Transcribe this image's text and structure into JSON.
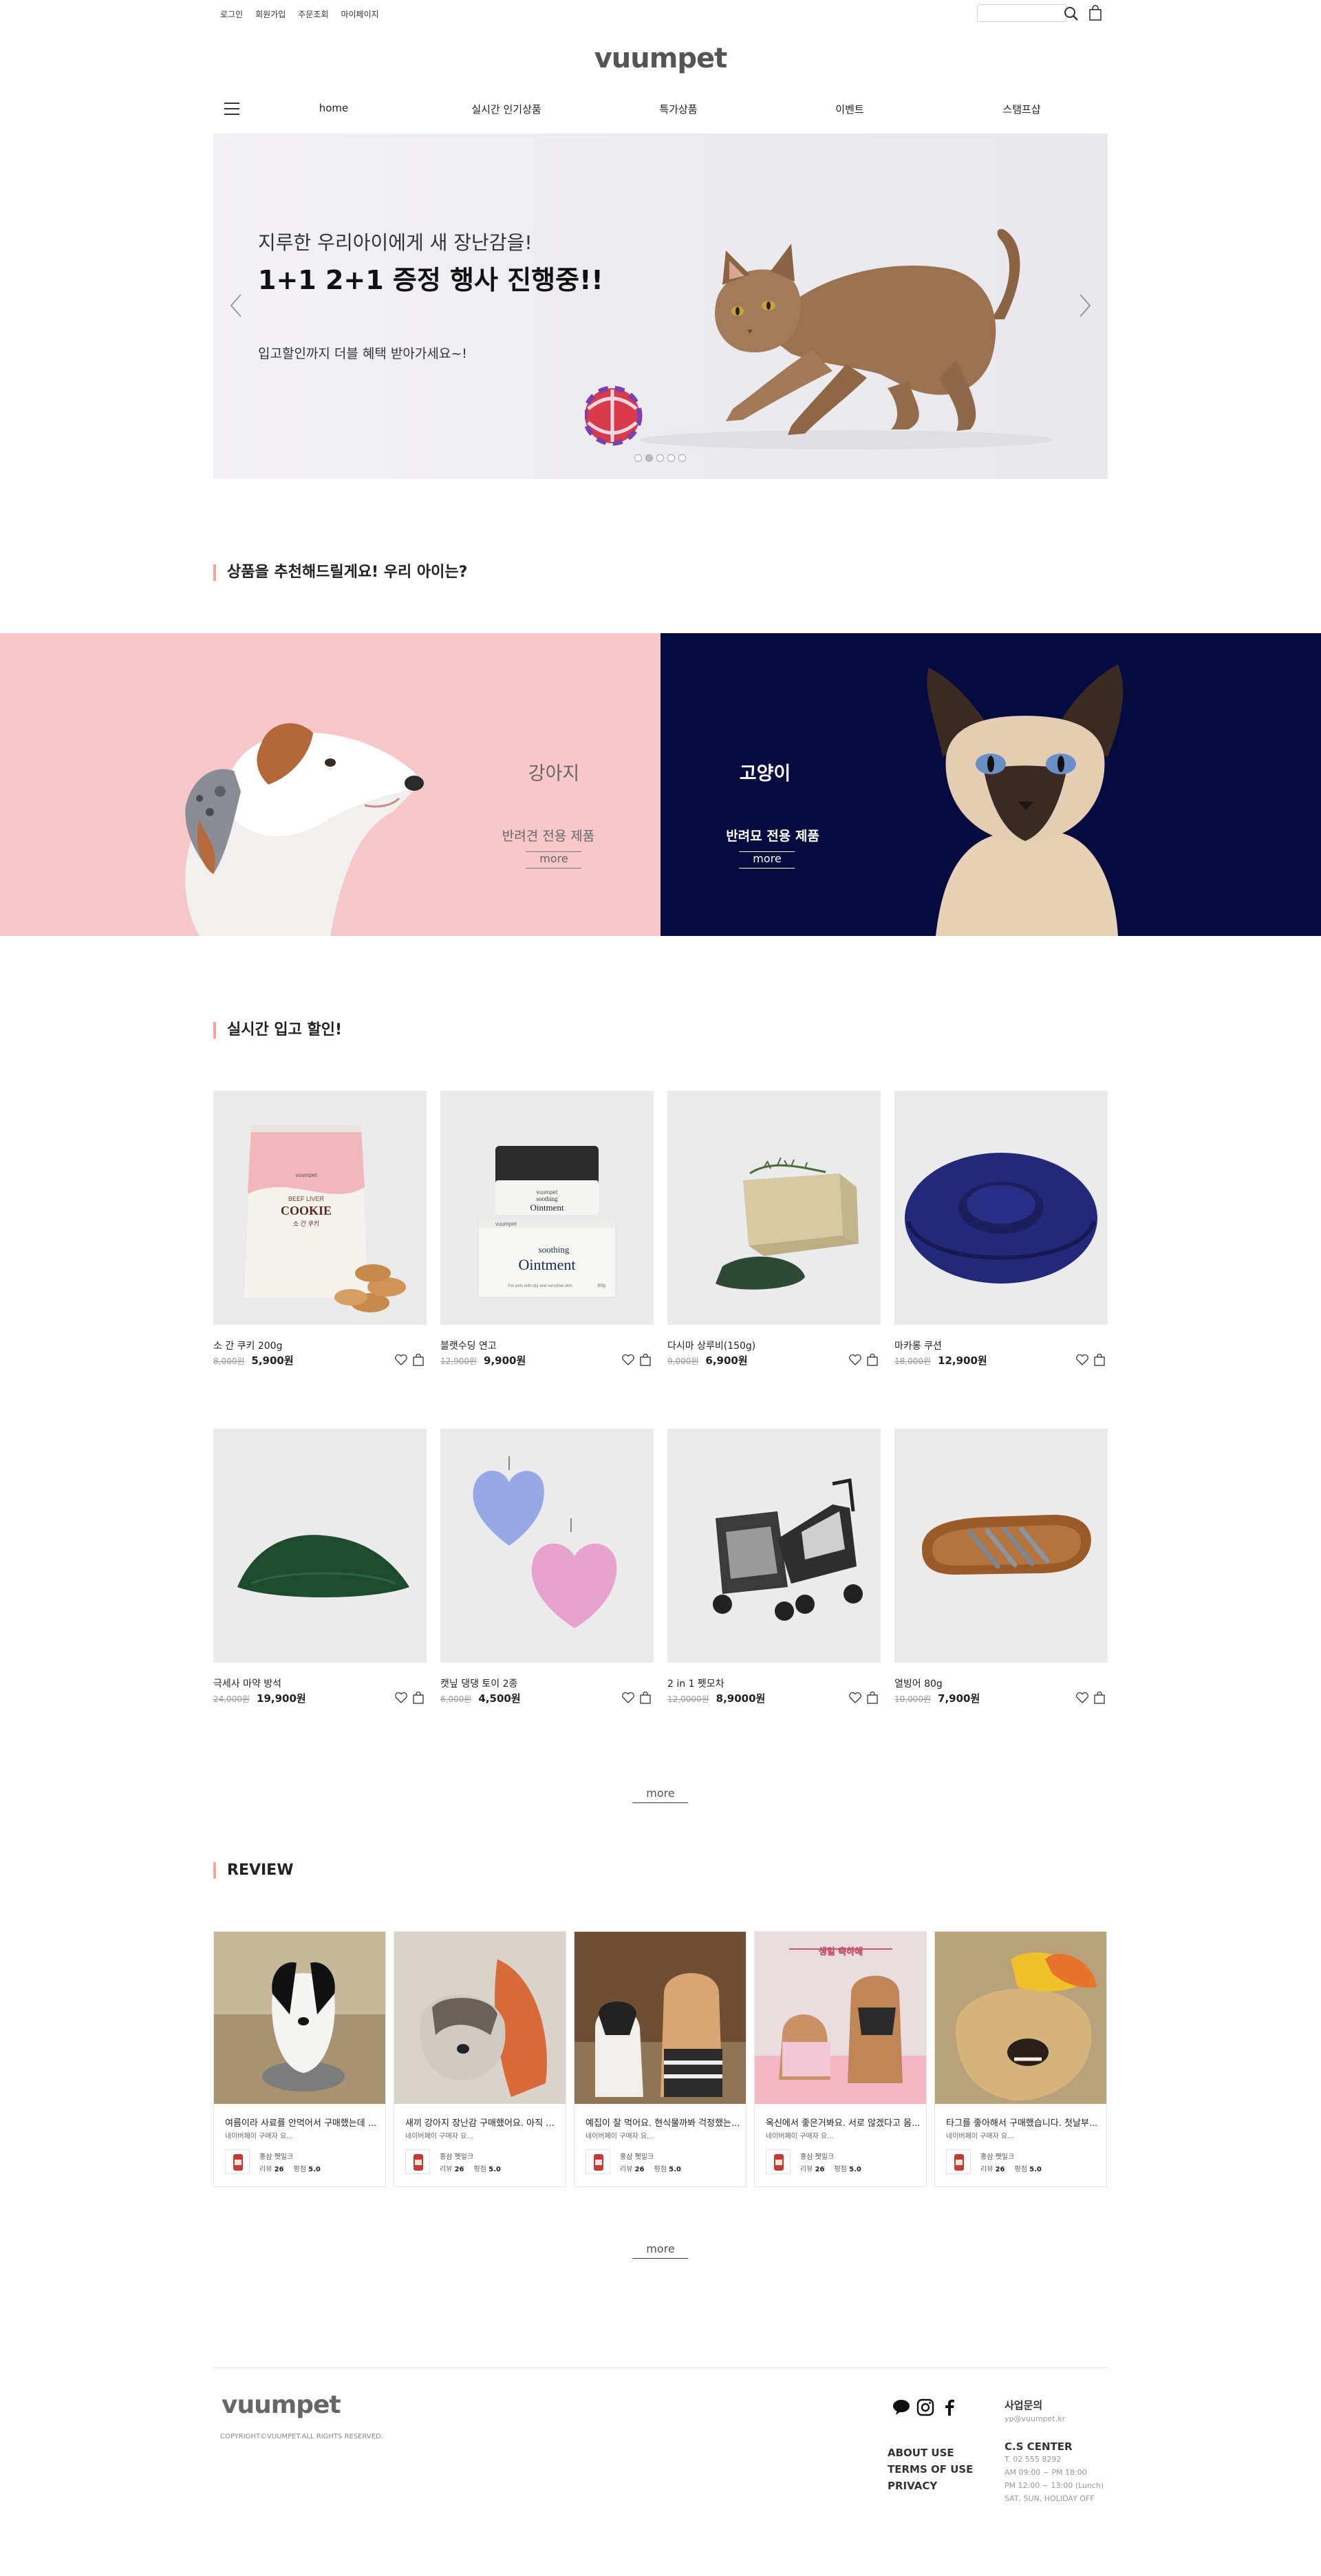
{
  "topbar": {
    "links": [
      "로그인",
      "회원가입",
      "주문조회",
      "마이페이지"
    ],
    "search_placeholder": ""
  },
  "brand": {
    "logo": "vuumpet"
  },
  "nav": {
    "items": [
      "home",
      "실시간 인기상품",
      "특가상품",
      "이벤트",
      "스탬프샵"
    ]
  },
  "hero": {
    "sub": "지루한 우리아이에게 새 장난감을!",
    "headline": "1+1 2+1 증정 행사 진행중!!",
    "desc": "입고할인까지 더블 혜택 받아가세요~!",
    "slide_count": 5,
    "active_slide": 2
  },
  "recommend": {
    "title": "상품을 추천해드릴게요! 우리 아이는?",
    "dog": {
      "label": "강아지",
      "desc": "반려견 전용 제품",
      "more": "more"
    },
    "cat": {
      "label": "고양이",
      "desc": "반려묘 전용 제품",
      "more": "more"
    }
  },
  "products": {
    "title": "실시간 입고 할인!",
    "items": [
      {
        "name": "소 간 쿠키 200g",
        "old": "8,000원",
        "price": "5,900원"
      },
      {
        "name": "블랫수딩 연고",
        "old": "12,900원",
        "price": "9,900원"
      },
      {
        "name": "다시마 상루비(150g)",
        "old": "9,000원",
        "price": "6,900원"
      },
      {
        "name": "마카롱 쿠션",
        "old": "18,000원",
        "price": "12,900원"
      },
      {
        "name": "극세사 마약 방석",
        "old": "24,000원",
        "price": "19,900원"
      },
      {
        "name": "캣닢 댕댕 토이 2종",
        "old": "6,000원",
        "price": "4,500원"
      },
      {
        "name": "2 in 1 펫모차",
        "old": "12,0000원",
        "price": "8,9000원"
      },
      {
        "name": "열빙어 80g",
        "old": "10,000원",
        "price": "7,900원"
      }
    ],
    "more": "more",
    "cookie_pack": {
      "brand": "vuumpet",
      "line1": "BEEF LIVER",
      "line2": "COOKIE",
      "line3": "소 간 쿠키"
    },
    "ointment": {
      "jar_brand": "vuumpet",
      "jar_line1": "soothing",
      "jar_line2": "Ointment",
      "box_brand": "vuumpet",
      "box_line1": "soothing",
      "box_line2": "Ointment",
      "box_small": "For pets with dry and sensitive skin",
      "box_weight": "60g"
    }
  },
  "reviews": {
    "title": "REVIEW",
    "items": [
      {
        "title": "여름이라 사료를 안먹어서 구매했는데 ...",
        "text": "네이버페이 구매자 요...",
        "product": "홍삼 펫밀크",
        "count": "26",
        "rating": "5.0"
      },
      {
        "title": "새끼 강아지 장난감 구매했어요. 아직 ...",
        "text": "네이버페이 구매자 요...",
        "product": "홍삼 펫밀크",
        "count": "26",
        "rating": "5.0"
      },
      {
        "title": "예집이 잘 먹어요. 현식물까봐 걱정했는...",
        "text": "네이버페이 구매자 요...",
        "product": "홍삼 펫밀크",
        "count": "26",
        "rating": "5.0"
      },
      {
        "title": "옥신에서 좋은거봐요. 서로 않겠다고 몸...",
        "text": "네이버페이 구매자 요...",
        "product": "홍삼 펫밀크",
        "count": "26",
        "rating": "5.0"
      },
      {
        "title": "타그를 좋아해서 구매했습니다. 첫날부...",
        "text": "네이버페이 구매자 요...",
        "product": "홍삼 펫밀크",
        "count": "26",
        "rating": "5.0"
      }
    ],
    "count_label": "리뷰",
    "rating_label": "평점",
    "more": "more",
    "banner_text": "생일 축하해"
  },
  "footer": {
    "logo": "vuumpet",
    "copyright": "COPYRIGHT©VUUMPET.ALL RIGHTS RESERVED.",
    "links": [
      "ABOUT USE",
      "TERMS OF USE",
      "PRIVACY"
    ],
    "business": {
      "title": "사업문의",
      "email": "yp@vuumpet.kr"
    },
    "cs": {
      "title": "C.S CENTER",
      "lines": [
        "T. 02 555 8292",
        "AM 09:00 ~ PM 18:00",
        "PM 12:00 ~ 13:00 (Lunch)",
        "SAT, SUN, HOLIDAY OFF"
      ]
    }
  },
  "colors": {
    "accent": "#f4a3a0",
    "dog_bg": "#f7c8c9",
    "cat_bg": "#050a3f",
    "thumb_bg": "#ebebeb"
  }
}
